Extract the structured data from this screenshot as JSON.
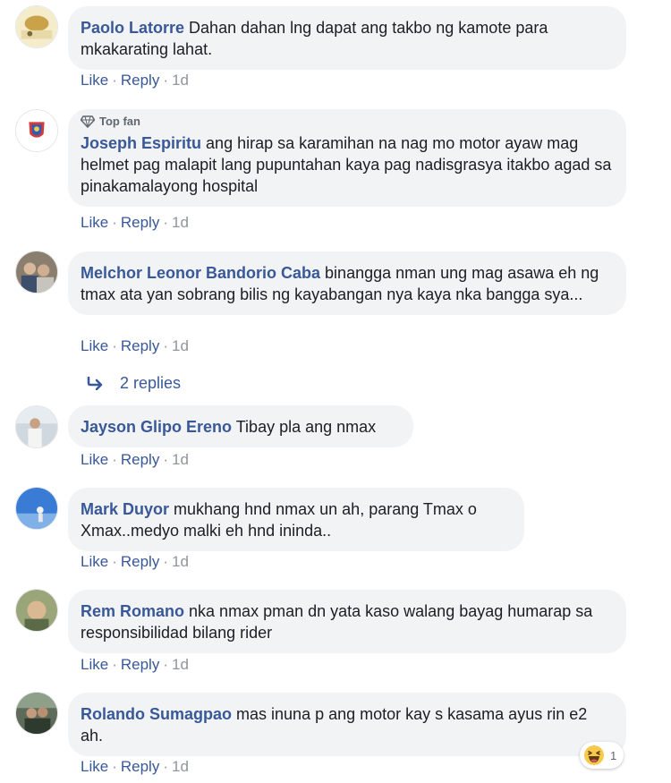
{
  "comments": [
    {
      "author": "Paolo Latorre",
      "text": "Dahan dahan lng dapat ang takbo ng kamote para mkakarating lahat.",
      "like": "Like",
      "reply": "Reply",
      "time": "1d"
    },
    {
      "badge": "Top fan",
      "author": "Joseph Espiritu",
      "text": "ang hirap sa karamihan na nag mo motor ayaw mag helmet pag malapit lang pupuntahan kaya pag nadisgrasya itakbo agad sa pinakamalayong hospital",
      "like": "Like",
      "reply": "Reply",
      "time": "1d"
    },
    {
      "author": "Melchor Leonor Bandorio Caba",
      "text": "binangga nman ung mag asawa eh ng tmax ata yan sobrang bilis ng kayabangan nya kaya nka bangga sya...",
      "like": "Like",
      "reply": "Reply",
      "time": "1d",
      "replies_label": "2 replies"
    },
    {
      "author": "Jayson Glipo Ereno",
      "text": "Tibay pla ang nmax",
      "like": "Like",
      "reply": "Reply",
      "time": "1d"
    },
    {
      "author": "Mark Duyor",
      "text": "mukhang hnd nmax un ah, parang Tmax o Xmax..medyo malki eh hnd ininda..",
      "like": "Like",
      "reply": "Reply",
      "time": "1d"
    },
    {
      "author": "Rem Romano",
      "text": "nka nmax pman dn yata kaso walang bayag humarap sa responsibilidad bilang rider",
      "like": "Like",
      "reply": "Reply",
      "time": "1d"
    },
    {
      "author": "Rolando Sumagpao",
      "text": "mas inuna p ang motor kay s kasama ayus rin e2 ah.",
      "like": "Like",
      "reply": "Reply",
      "time": "1d",
      "reaction": {
        "icon": "haha-emoji-icon",
        "count": "1"
      }
    }
  ],
  "separator": "·",
  "colors": {
    "link": "#385898",
    "bubble": "#f2f3f5",
    "meta": "#90949c"
  }
}
